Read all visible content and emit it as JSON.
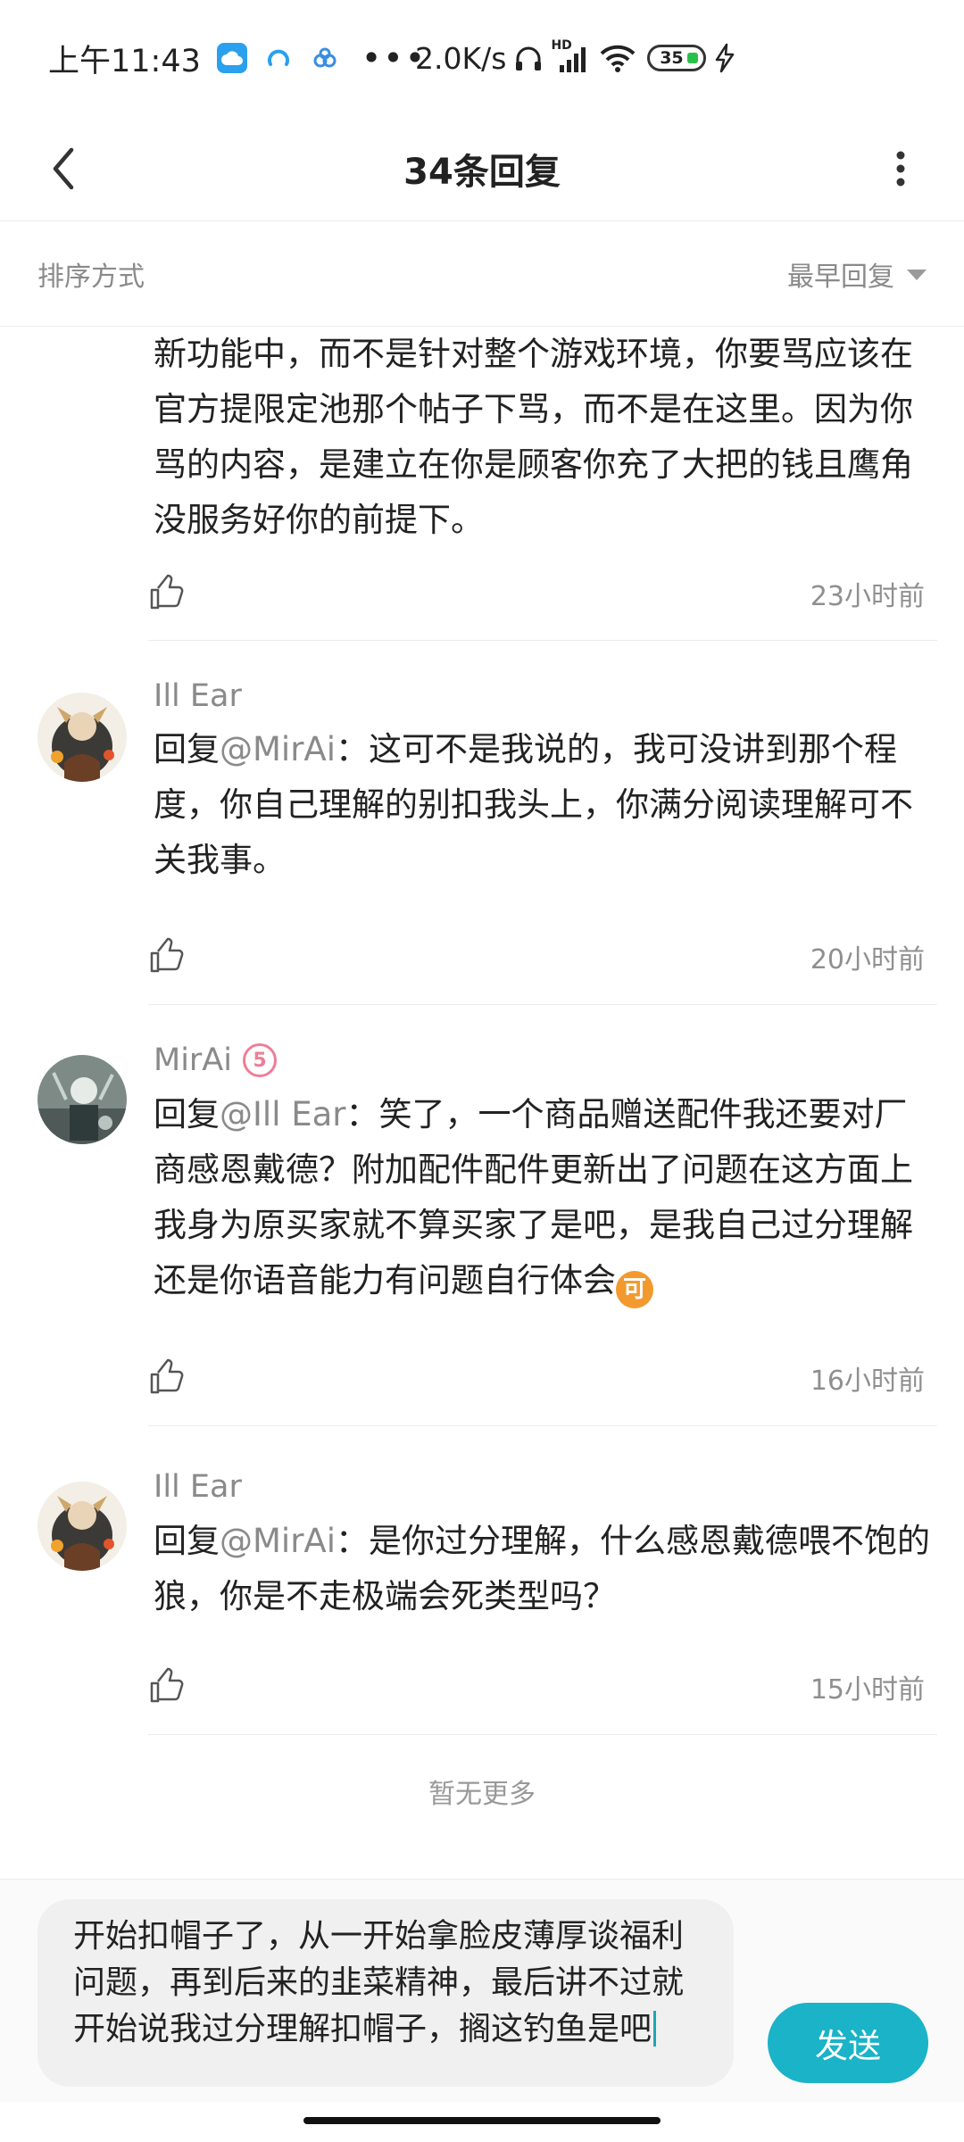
{
  "status_bar": {
    "time": "上午11:43",
    "overflow": "•••",
    "net_speed": "2.0K/s",
    "signal_tag": "HD",
    "battery": "35"
  },
  "header": {
    "title": "34条回复"
  },
  "sort": {
    "label": "排序方式",
    "value": "最早回复"
  },
  "comments": [
    {
      "text": "新功能中，而不是针对整个游戏环境，你要骂应该在官方提限定池那个帖子下骂，而不是在这里。因为你骂的内容，是建立在你是顾客你充了大把的钱且鹰角没服务好你的前提下。",
      "time": "23小时前"
    },
    {
      "user": "Ill Ear",
      "reply_prefix": "回复",
      "reply_to": "@MirAi",
      "text": "：这可不是我说的，我可没讲到那个程度，你自己理解的别扣我头上，你满分阅读理解可不关我事。",
      "time": "20小时前"
    },
    {
      "user": "MirAi",
      "level": "5",
      "reply_prefix": "回复",
      "reply_to": "@Ill Ear",
      "text": "：笑了，一个商品赠送配件我还要对厂商感恩戴德？附加配件配件更新出了问题在这方面上我身为原买家就不算买家了是吧，是我自己过分理解还是你语音能力有问题自行体会",
      "emoji": "可",
      "time": "16小时前"
    },
    {
      "user": "Ill Ear",
      "reply_prefix": "回复",
      "reply_to": "@MirAi",
      "text": "：是你过分理解，什么感恩戴德喂不饱的狼，你是不走极端会死类型吗？",
      "time": "15小时前"
    }
  ],
  "no_more": "暂无更多",
  "composer": {
    "value": "开始扣帽子了，从一开始拿脸皮薄厚谈福利问题，再到后来的韭菜精神，最后讲不过就开始说我过分理解扣帽子，搁这钓鱼是吧",
    "send_label": "发送"
  },
  "colors": {
    "accent": "#1ab3c8",
    "meta_gray": "#8f8f8f",
    "level_pink": "#ef7d98",
    "emoji_orange": "#f29a2e"
  }
}
